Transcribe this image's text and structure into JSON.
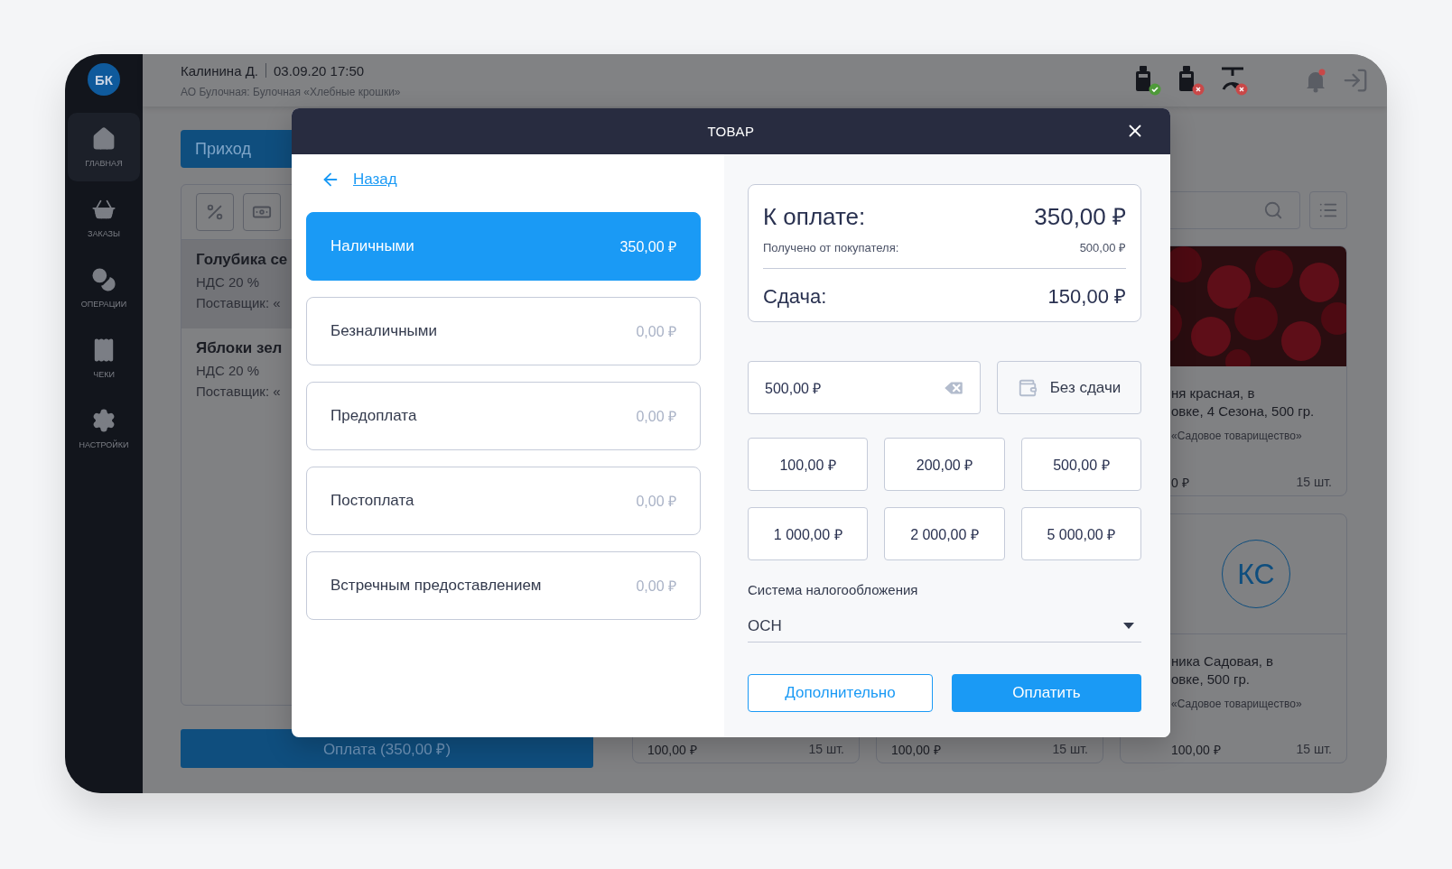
{
  "user": {
    "name": "Калинина Д.",
    "datetime": "03.09.20 17:50",
    "org": "АО Булочная: Булочная «Хлебные крошки»"
  },
  "sidebar": {
    "avatar": "БК",
    "items": [
      {
        "label": "ГЛАВНАЯ",
        "selected": true
      },
      {
        "label": "ЗАКАЗЫ",
        "selected": false
      },
      {
        "label": "ОПЕРАЦИИ",
        "selected": false
      },
      {
        "label": "ЧЕКИ",
        "selected": false
      },
      {
        "label": "НАСТРОЙКИ",
        "selected": false
      }
    ]
  },
  "devices": [
    {
      "kind": "terminal",
      "connected": true
    },
    {
      "kind": "terminal",
      "connected": false
    },
    {
      "kind": "scale",
      "connected": false
    }
  ],
  "notifications": {
    "unread": true
  },
  "action_button": "Приход",
  "order_list": [
    {
      "name": "Голубика се",
      "vat": "НДС 20 %",
      "supplier": "Поставщик: «",
      "selected": true
    },
    {
      "name": "Яблоки зел",
      "vat": "НДС 20 %",
      "supplier": "Поставщик: «",
      "selected": false
    }
  ],
  "pay_button": "Оплата (350,00 ₽)",
  "products": [
    {
      "title_lines": [
        "ня красная, в",
        "овке, 4 Сезона, 500 гр."
      ],
      "supplier": "«Садовое товарищество»",
      "price": "0 ₽",
      "qty": "15 шт."
    },
    {
      "kind": "partial",
      "price": "100,00 ₽",
      "qty": "15 шт."
    },
    {
      "kind": "partial",
      "price": "100,00 ₽",
      "qty": "15 шт."
    },
    {
      "kind": "initials",
      "initials": "КС",
      "title_lines": [
        "ника Садовая, в",
        "овке, 500 гр."
      ],
      "supplier": "«Садовое товарищество»",
      "price": "100,00 ₽",
      "qty": "15 шт."
    }
  ],
  "modal": {
    "title": "ТОВАР",
    "back": "Назад",
    "methods": [
      {
        "label": "Наличными",
        "amount": "350,00 ₽",
        "selected": true
      },
      {
        "label": "Безналичными",
        "amount": "0,00 ₽",
        "selected": false
      },
      {
        "label": "Предоплата",
        "amount": "0,00 ₽",
        "selected": false
      },
      {
        "label": "Постоплата",
        "amount": "0,00 ₽",
        "selected": false
      },
      {
        "label": "Встречным предоставлением",
        "amount": "0,00 ₽",
        "selected": false
      }
    ],
    "summary": {
      "due_label": "К оплате:",
      "due": "350,00 ₽",
      "received_label": "Получено от покупателя:",
      "received": "500,00 ₽",
      "change_label": "Сдача:",
      "change": "150,00 ₽"
    },
    "cash_input": {
      "value": "500,00 ₽"
    },
    "no_change_button": "Без сдачи",
    "presets": [
      "100,00 ₽",
      "200,00 ₽",
      "500,00 ₽",
      "1 000,00 ₽",
      "2 000,00 ₽",
      "5 000,00 ₽"
    ],
    "tax": {
      "label": "Система налогообложения",
      "value": "ОСН"
    },
    "more_button": "Дополнительно",
    "confirm_button": "Оплатить"
  }
}
